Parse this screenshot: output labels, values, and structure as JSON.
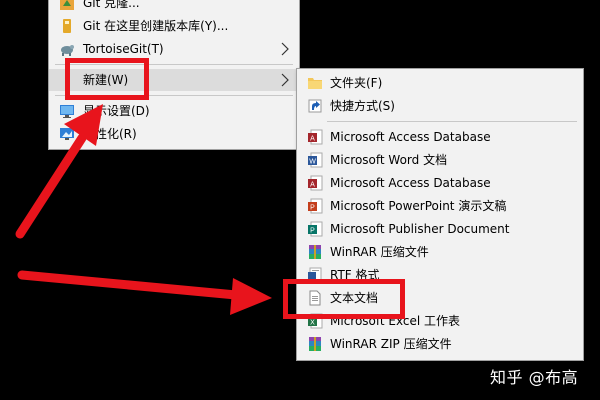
{
  "context_menu": {
    "items": [
      {
        "label": "Git 克隆...",
        "icon": "git-clone-icon"
      },
      {
        "label": "Git 在这里创建版本库(Y)...",
        "icon": "git-init-icon"
      },
      {
        "label": "TortoiseGit(T)",
        "icon": "tortoisegit-icon"
      },
      {
        "label": "新建(W)",
        "icon": "none"
      },
      {
        "label": "显示设置(D)",
        "icon": "display-icon"
      },
      {
        "label": "个性化(R)",
        "icon": "personalize-icon"
      }
    ]
  },
  "new_submenu": {
    "items": [
      {
        "label": "文件夹(F)",
        "icon": "folder-icon"
      },
      {
        "label": "快捷方式(S)",
        "icon": "shortcut-icon"
      },
      {
        "label": "Microsoft Access Database",
        "icon": "access-icon"
      },
      {
        "label": "Microsoft Word 文档",
        "icon": "word-icon"
      },
      {
        "label": "Microsoft Access Database",
        "icon": "access-icon"
      },
      {
        "label": "Microsoft PowerPoint 演示文稿",
        "icon": "powerpoint-icon"
      },
      {
        "label": "Microsoft Publisher Document",
        "icon": "publisher-icon"
      },
      {
        "label": "WinRAR 压缩文件",
        "icon": "winrar-icon"
      },
      {
        "label": "RTF 格式",
        "icon": "rtf-icon"
      },
      {
        "label": "文本文档",
        "icon": "text-document-icon"
      },
      {
        "label": "Microsoft Excel 工作表",
        "icon": "excel-icon"
      },
      {
        "label": "WinRAR ZIP 压缩文件",
        "icon": "winrar-zip-icon"
      }
    ]
  },
  "watermark": "知乎 @布高",
  "colors": {
    "annotation_red": "#e8141c",
    "menu_bg": "#f2f2f2",
    "background": "#000000"
  }
}
